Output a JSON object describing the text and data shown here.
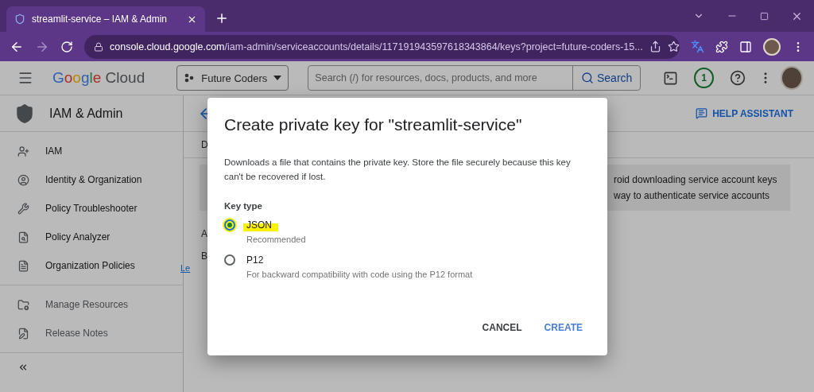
{
  "browser": {
    "tab_title": "streamlit-service – IAM & Admin",
    "url_host": "console.cloud.google.com",
    "url_path": "/iam-admin/serviceaccounts/details/117191943597618343864/keys?project=future-coders-15..."
  },
  "app_bar": {
    "logo_google": "Google",
    "logo_cloud": "Cloud",
    "project": "Future Coders",
    "search_placeholder": "Search (/) for resources, docs, products, and more",
    "search_button": "Search",
    "notifications": "1"
  },
  "sidebar": {
    "title": "IAM & Admin",
    "items": [
      {
        "label": "IAM"
      },
      {
        "label": "Identity & Organization"
      },
      {
        "label": "Policy Troubleshooter"
      },
      {
        "label": "Policy Analyzer"
      },
      {
        "label": "Organization Policies"
      }
    ],
    "footer_items": [
      {
        "label": "Manage Resources"
      },
      {
        "label": "Release Notes"
      }
    ]
  },
  "content": {
    "help_assistant": "HELP ASSISTANT",
    "tab_fragment": "D",
    "banner_lines": [
      "roid downloading service account keys",
      "way to authenticate service accounts"
    ],
    "fragments": [
      "A",
      "B"
    ],
    "link_fragment": "Le"
  },
  "dialog": {
    "title": "Create private key for \"streamlit-service\"",
    "description": "Downloads a file that contains the private key. Store the file securely because this key can't be recovered if lost.",
    "key_type_label": "Key type",
    "options": [
      {
        "label": "JSON",
        "hint": "Recommended",
        "selected": true,
        "highlighted": true
      },
      {
        "label": "P12",
        "hint": "For backward compatibility with code using the P12 format",
        "selected": false,
        "highlighted": false
      }
    ],
    "cancel": "CANCEL",
    "create": "CREATE"
  }
}
